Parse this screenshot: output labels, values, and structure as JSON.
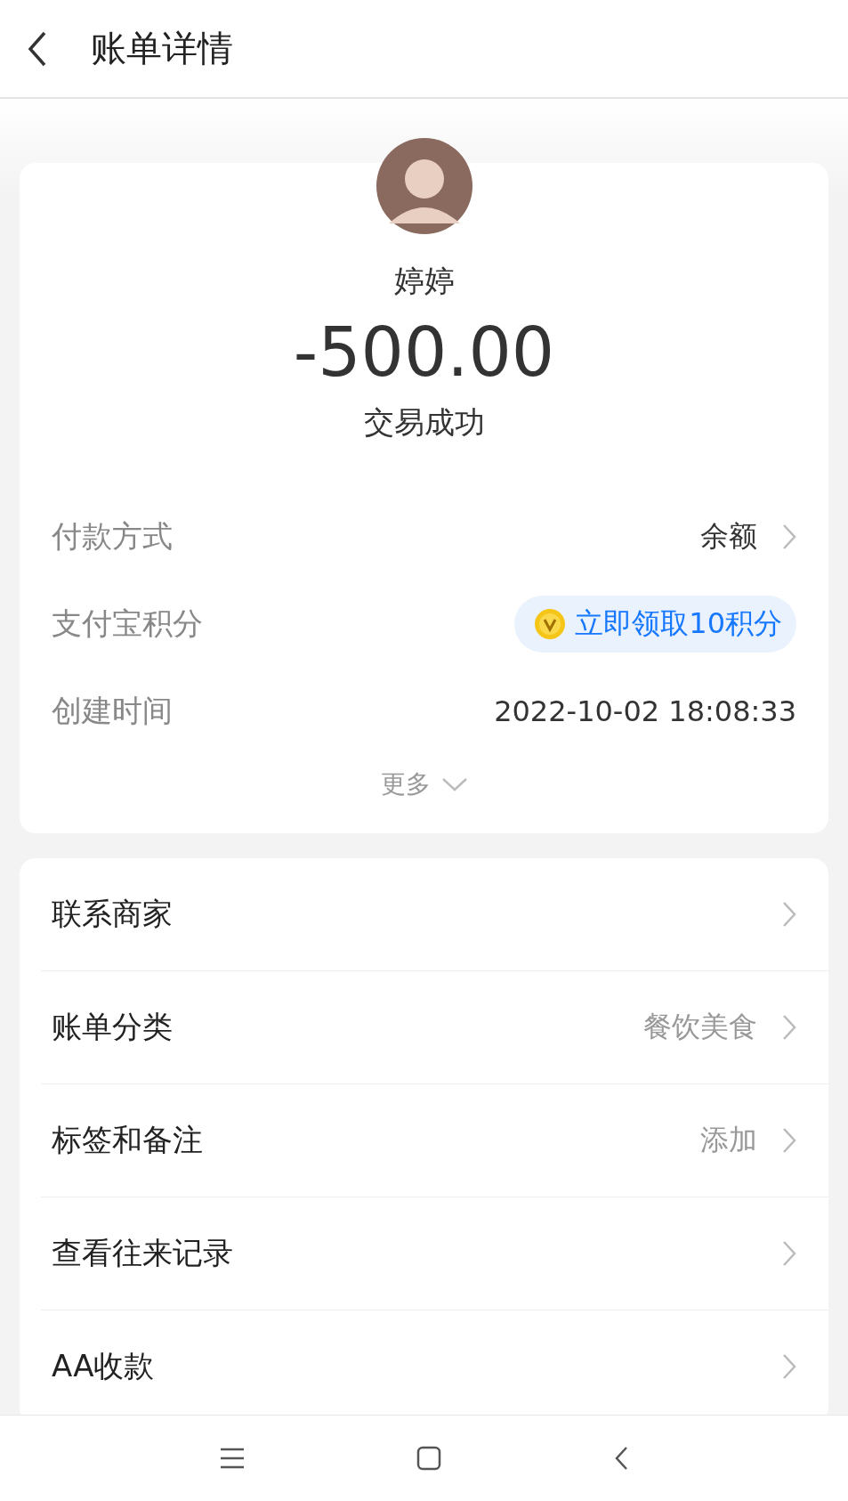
{
  "header": {
    "title": "账单详情"
  },
  "summary": {
    "name": "婷婷",
    "amount": "-500.00",
    "status": "交易成功"
  },
  "details": [
    {
      "kind": "link",
      "label": "付款方式",
      "value": "余额"
    },
    {
      "kind": "reward",
      "label": "支付宝积分",
      "value": "立即领取10积分"
    },
    {
      "kind": "plain",
      "label": "创建时间",
      "value": "2022-10-02 18:08:33"
    }
  ],
  "more": "更多",
  "actions": [
    {
      "label": "联系商家"
    },
    {
      "label": "账单分类",
      "value": "餐饮美食"
    },
    {
      "label": "标签和备注",
      "value": "添加"
    },
    {
      "label": "查看往来记录"
    },
    {
      "label": "AA收款"
    }
  ]
}
